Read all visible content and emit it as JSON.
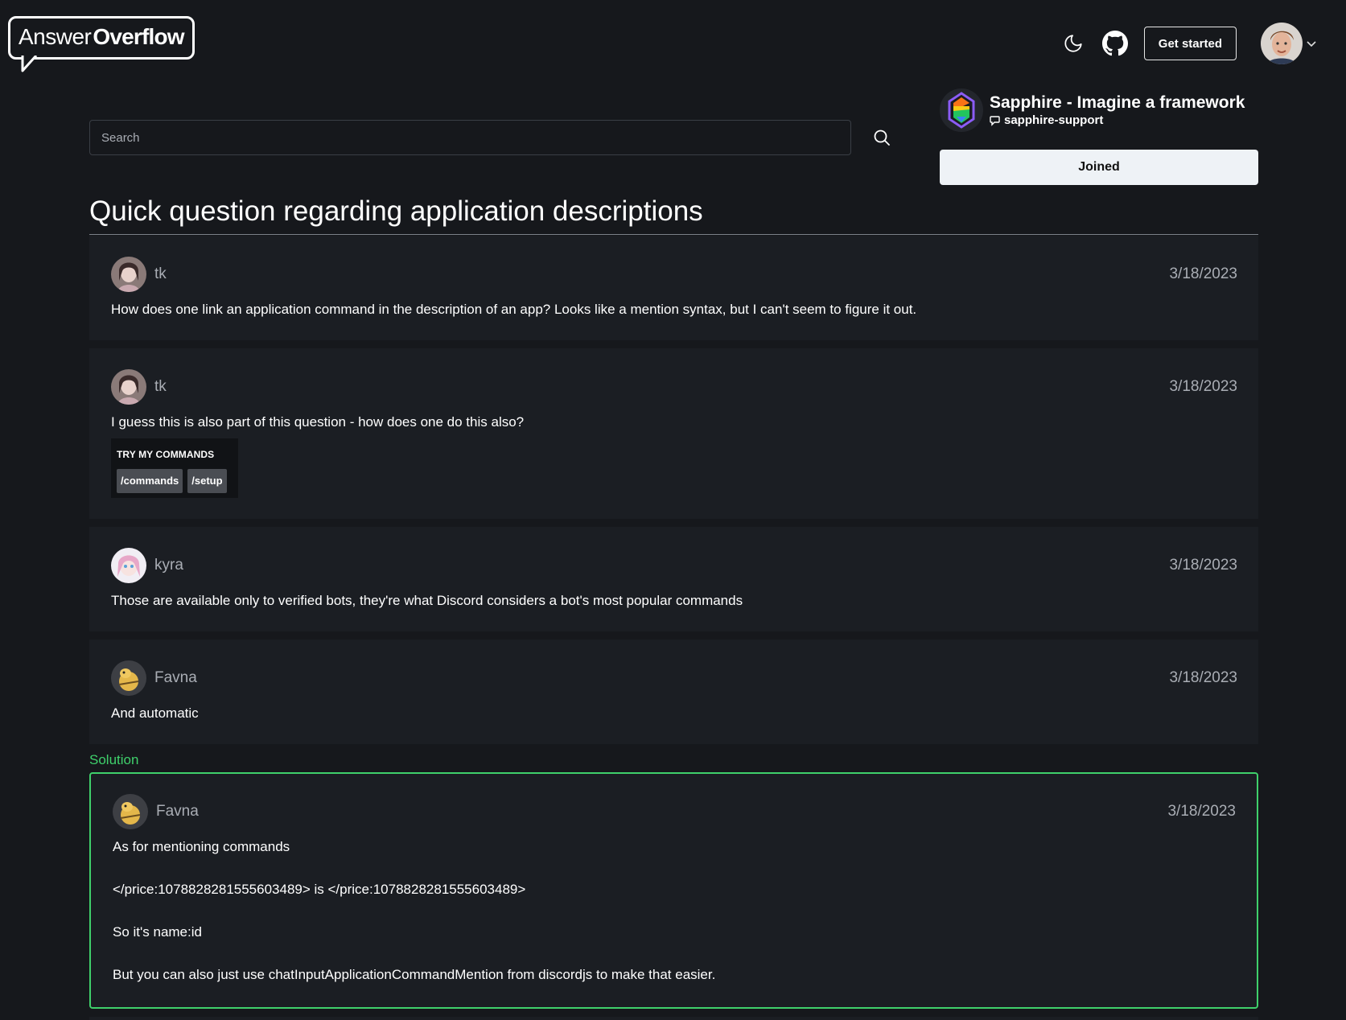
{
  "brand": {
    "answer": "Answer",
    "overflow": "Overflow"
  },
  "header": {
    "get_started_label": "Get started"
  },
  "server": {
    "name": "Sapphire - Imagine a framework",
    "channel": "sapphire-support",
    "joined_label": "Joined"
  },
  "search": {
    "placeholder": "Search"
  },
  "thread": {
    "title": "Quick question regarding application descriptions"
  },
  "messages": [
    {
      "author": "tk",
      "date": "3/18/2023",
      "text": "How does one link an application command in the description of an app? Looks like a mention syntax, but I can't seem to figure it out."
    },
    {
      "author": "tk",
      "date": "3/18/2023",
      "text": "I guess this is also part of this question - how does one do this also?",
      "embed": {
        "title": "TRY MY COMMANDS",
        "commands": [
          "/commands",
          "/setup"
        ]
      }
    },
    {
      "author": "kyra",
      "date": "3/18/2023",
      "text": "Those are available only to verified bots, they're what Discord considers a bot's most popular commands"
    },
    {
      "author": "Favna",
      "date": "3/18/2023",
      "text": "And automatic"
    }
  ],
  "solution": {
    "label": "Solution",
    "author": "Favna",
    "date": "3/18/2023",
    "paragraphs": [
      "As for mentioning commands",
      "</price:1078828281555603489> is </price:1078828281555603489>",
      "So it's name:id",
      "But you can also just use chatInputApplicationCommandMention from discordjs to make that easier."
    ]
  },
  "colors": {
    "background": "#16181c",
    "card": "#1b1e23",
    "solution_accent": "#3fd06b"
  }
}
